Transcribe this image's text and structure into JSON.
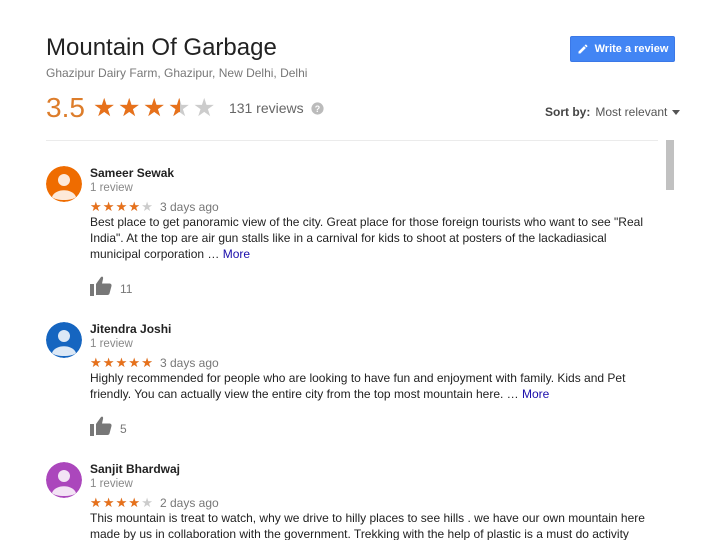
{
  "place": {
    "title": "Mountain Of Garbage",
    "address": "Ghazipur Dairy Farm, Ghazipur, New Delhi, Delhi"
  },
  "write_review_label": "Write a review",
  "summary": {
    "rating_text": "3.5",
    "rating_value": 3.5,
    "max_stars": 5,
    "count_text": "131 reviews"
  },
  "sort": {
    "label": "Sort by:",
    "value": "Most relevant"
  },
  "colors": {
    "accent": "#4285f4",
    "star": "#e7711b",
    "star_empty": "#cccccc",
    "link": "#1a0dab"
  },
  "icons": {
    "write": "pencil-icon",
    "help": "help-icon",
    "sort": "caret-down-icon",
    "like": "thumbs-up-icon",
    "avatar": "person-icon"
  },
  "reviews": [
    {
      "author": "Sameer Sewak",
      "reviews_text": "1 review",
      "stars": 4,
      "date": "3 days ago",
      "text": "Best place to get panoramic view of the city. Great place for those foreign tourists who want to see \"Real India\". At the top are air gun stalls like in a carnival for kids to shoot at posters of the lackadiasical municipal corporation …",
      "more_label": "More",
      "likes": "11",
      "avatar_color": "#ef6c00"
    },
    {
      "author": "Jitendra Joshi",
      "reviews_text": "1 review",
      "stars": 5,
      "date": "3 days ago",
      "text": "Highly recommended for people who are looking to have fun and enjoyment with family.  Kids and Pet friendly. You can actually view the entire city from the top most mountain here. …",
      "more_label": "More",
      "likes": "5",
      "avatar_color": "#1565c0"
    },
    {
      "author": "Sanjit Bhardwaj",
      "reviews_text": "1 review",
      "stars": 4,
      "date": "2 days ago",
      "text": "This mountain is treat to watch, why we drive to hilly places to see hills . we have our own mountain here made by us in collaboration with the government. Trekking with the help of plastic is a must do activity",
      "avatar_color": "#ab47bc"
    }
  ]
}
